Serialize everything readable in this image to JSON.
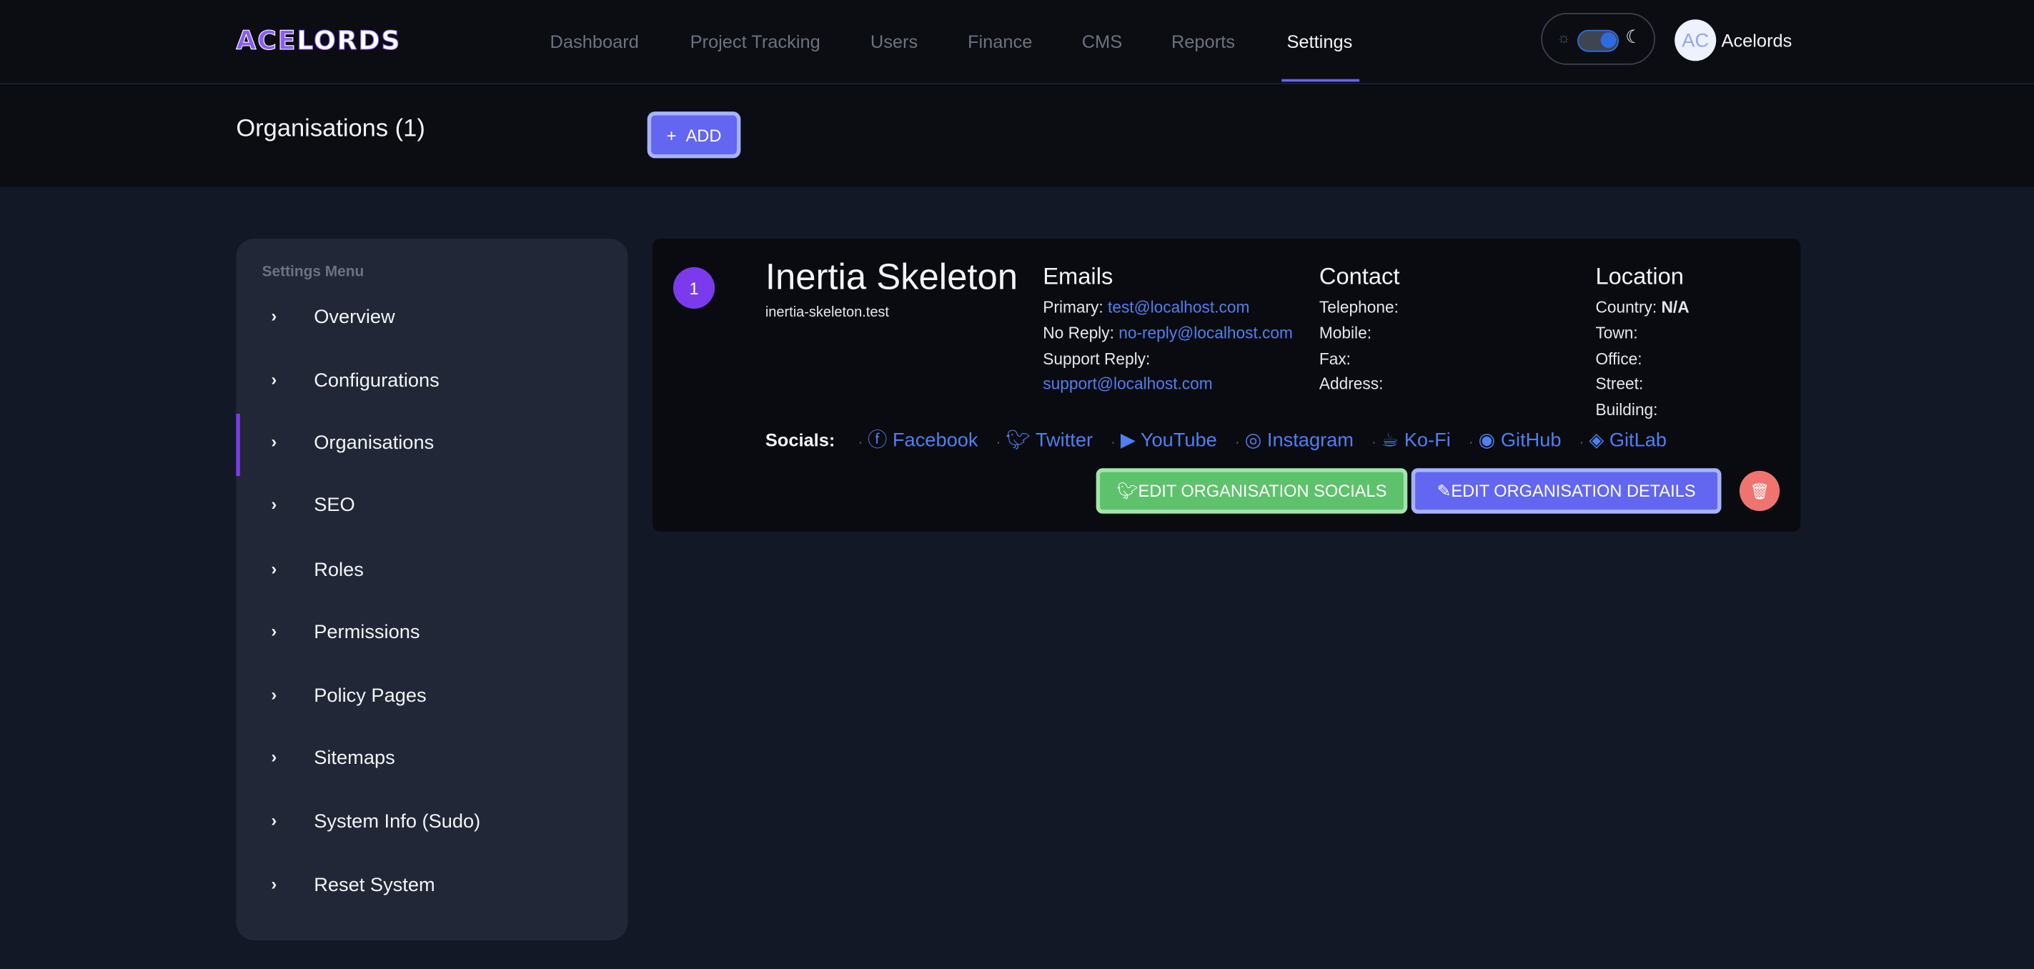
{
  "header": {
    "logo": "ACELORDS",
    "nav": [
      "Dashboard",
      "Project Tracking",
      "Users",
      "Finance",
      "CMS",
      "Reports",
      "Settings"
    ],
    "active_nav": "Settings",
    "user": {
      "initials": "AC",
      "name": "Acelords"
    },
    "theme": "dark"
  },
  "subheader": {
    "title": "Organisations (1)",
    "add_label": "ADD"
  },
  "sidebar": {
    "title": "Settings Menu",
    "items": [
      "Overview",
      "Configurations",
      "Organisations",
      "SEO",
      "Roles",
      "Permissions",
      "Policy Pages",
      "Sitemaps",
      "System Info (Sudo)",
      "Reset System"
    ],
    "active": "Organisations"
  },
  "org": {
    "index": "1",
    "name": "Inertia Skeleton",
    "domain": "inertia-skeleton.test",
    "emails": {
      "title": "Emails",
      "primary_label": "Primary:",
      "primary": "test@localhost.com",
      "noreply_label": "No Reply:",
      "noreply": "no-reply@localhost.com",
      "support_label": "Support Reply:",
      "support": "support@localhost.com"
    },
    "contact": {
      "title": "Contact",
      "telephone": "Telephone:",
      "mobile": "Mobile:",
      "fax": "Fax:",
      "address": "Address:"
    },
    "location": {
      "title": "Location",
      "country_label": "Country:",
      "country": "N/A",
      "town": "Town:",
      "office": "Office:",
      "street": "Street:",
      "building": "Building:"
    },
    "socials_label": "Socials:",
    "socials": [
      "Facebook",
      "Twitter",
      "YouTube",
      "Instagram",
      "Ko-Fi",
      "GitHub",
      "GitLab"
    ],
    "edit_socials": "EDIT ORGANISATION SOCIALS",
    "edit_details": "EDIT ORGANISATION DETAILS"
  },
  "colors": {
    "accent": "#6366f1",
    "active": "#7c3aed",
    "link": "#4f7ff0",
    "success": "#5ec26d",
    "danger": "#ef7470"
  }
}
